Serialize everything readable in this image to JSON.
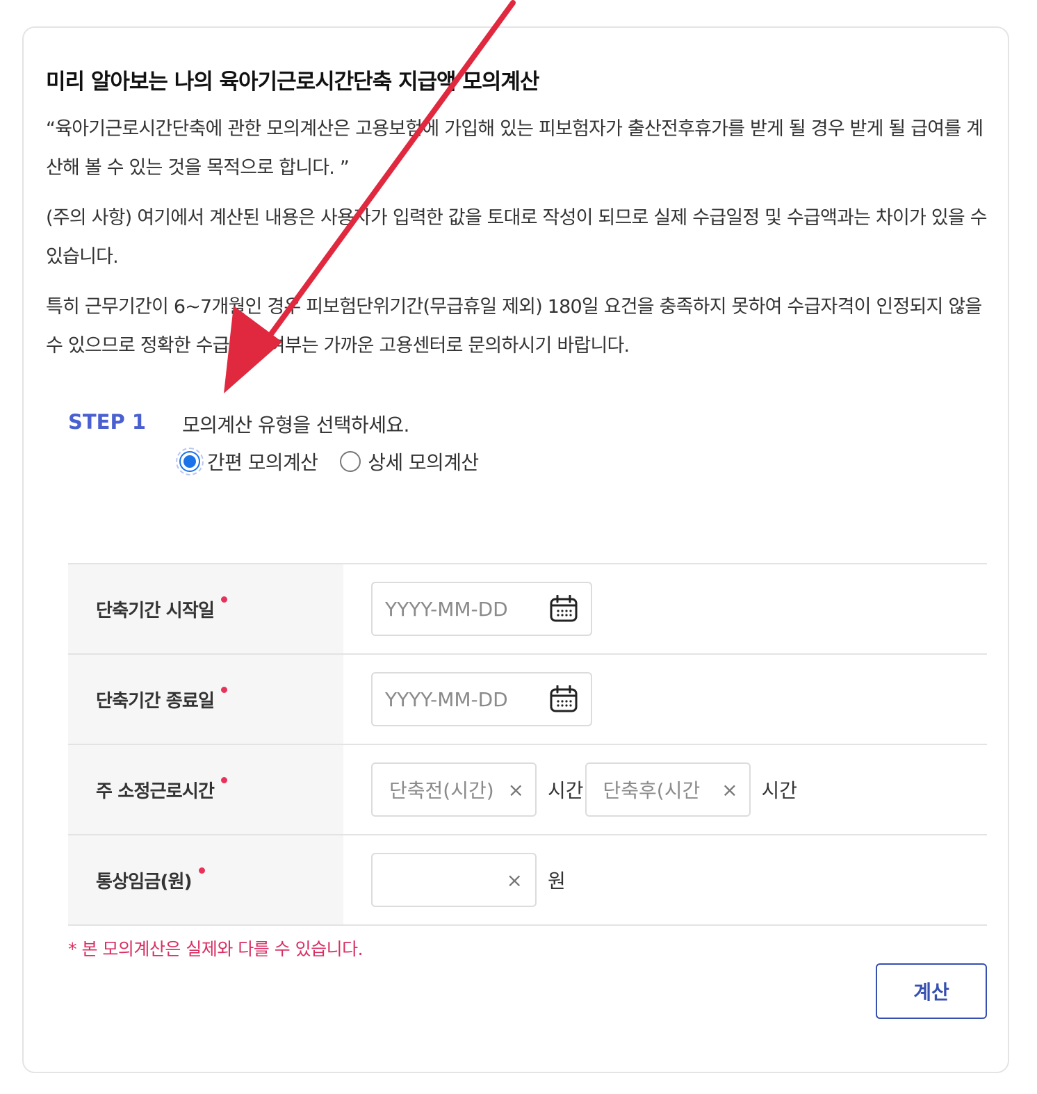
{
  "title": "미리 알아보는 나의 육아기근로시간단축 지급액 모의계산",
  "paragraphs": [
    "“육아기근로시간단축에 관한 모의계산은 고용보험에 가입해 있는 피보험자가 출산전후휴가를 받게 될 경우 받게 될 급여를 계산해 볼 수 있는 것을 목적으로 합니다. ”",
    "(주의 사항) 여기에서 계산된 내용은 사용자가 입력한 값을 토대로 작성이 되므로 실제 수급일정 및 수급액과는 차이가 있을 수 있습니다.",
    "특히 근무기간이 6~7개월인 경우 피보험단위기간(무급휴일 제외) 180일 요건을 충족하지 못하여 수급자격이 인정되지 않을 수 있으므로 정확한 수급가능 여부는 가까운 고용센터로 문의하시기 바랍니다."
  ],
  "step": {
    "label": "STEP 1",
    "instruction": "모의계산 유형을 선택하세요.",
    "options": [
      {
        "label": "간편 모의계산",
        "checked": true
      },
      {
        "label": "상세 모의계산",
        "checked": false
      }
    ]
  },
  "form": {
    "start_label": "단축기간 시작일",
    "start_placeholder": "YYYY-MM-DD",
    "end_label": "단축기간 종료일",
    "end_placeholder": "YYYY-MM-DD",
    "hours_label": "주 소정근로시간",
    "hours_before_placeholder": "단축전(시간)",
    "hours_after_placeholder": "단축후(시간",
    "hours_unit": "시간",
    "wage_label": "통상임금(원)",
    "wage_value": "",
    "wage_unit": "원",
    "clear_symbol": "×"
  },
  "notice": "* 본 모의계산은 실제와 다를 수 있습니다.",
  "calc_button": "계산",
  "colors": {
    "accent": "#4a5fd0",
    "radio": "#1a73e8",
    "required": "#e8325a",
    "notice": "#d92f63",
    "arrow": "#e0283e",
    "button": "#3550b0"
  }
}
